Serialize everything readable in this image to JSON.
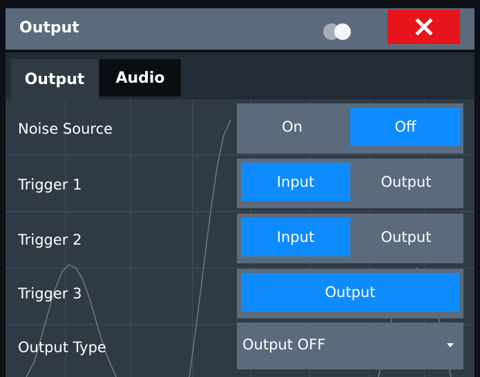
{
  "window": {
    "title": "Output"
  },
  "tabs": [
    {
      "label": "Output",
      "active": true
    },
    {
      "label": "Audio",
      "active": false
    }
  ],
  "rows": {
    "noise_source": {
      "label": "Noise Source",
      "options": [
        "On",
        "Off"
      ],
      "selected": "Off"
    },
    "trigger1": {
      "label": "Trigger 1",
      "options": [
        "Input",
        "Output"
      ],
      "selected": "Input"
    },
    "trigger2": {
      "label": "Trigger 2",
      "options": [
        "Input",
        "Output"
      ],
      "selected": "Input"
    },
    "trigger3": {
      "label": "Trigger 3",
      "options": [
        "Output"
      ],
      "selected": "Output"
    },
    "output_type": {
      "label": "Output Type",
      "value": "Output OFF"
    }
  },
  "colors": {
    "accent": "#0e8cff",
    "close": "#e8141b",
    "titlebar": "#5b6b7b",
    "background": "#303a45"
  },
  "icons": {
    "close": "close-x-icon",
    "toggle": "display-toggle-icon",
    "dropdown": "caret-down-icon"
  }
}
